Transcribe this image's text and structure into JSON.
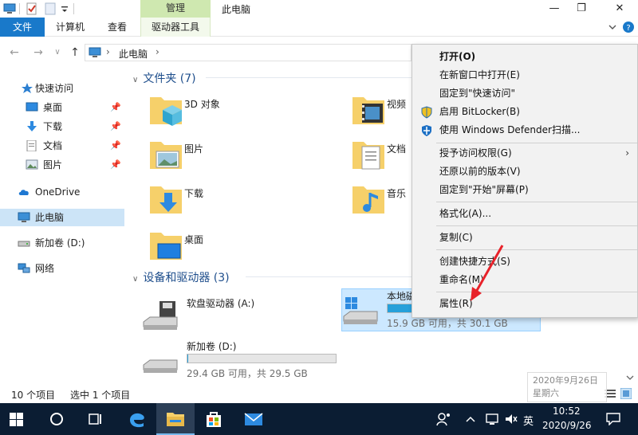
{
  "titlebar": {
    "manage_tab": "管理",
    "window_title": "此电脑",
    "min": "—",
    "max": "❐",
    "close": "✕"
  },
  "ribbon": {
    "tabs": [
      "文件",
      "计算机",
      "查看",
      "驱动器工具"
    ]
  },
  "address": {
    "back": "←",
    "forward": "→",
    "recent": "∨",
    "up": "↑",
    "path": "此电脑",
    "sep": "›"
  },
  "nav": {
    "quick_access": "快速访问",
    "quick_items": [
      "桌面",
      "下载",
      "文档",
      "图片"
    ],
    "onedrive": "OneDrive",
    "this_pc": "此电脑",
    "new_volume": "新加卷 (D:)",
    "network": "网络"
  },
  "content": {
    "folders_header": "文件夹 (7)",
    "folders": [
      "3D 对象",
      "视频",
      "图片",
      "文档",
      "下载",
      "音乐",
      "桌面"
    ],
    "devices_header": "设备和驱动器 (3)",
    "drives": [
      {
        "name": "软盘驱动器 (A:)",
        "free_text": "",
        "used_fraction": 0
      },
      {
        "name": "本地磁",
        "free_text": "15.9 GB 可用，共 30.1 GB",
        "used_fraction": 0.47
      },
      {
        "name": "新加卷 (D:)",
        "free_text": "29.4 GB 可用，共 29.5 GB",
        "used_fraction": 0.004
      }
    ]
  },
  "status": {
    "count": "10 个项目",
    "selected": "选中 1 个项目"
  },
  "context_menu": {
    "items": [
      "打开(O)",
      "在新窗口中打开(E)",
      "固定到\"快速访问\"",
      "启用 BitLocker(B)",
      "使用 Windows Defender扫描...",
      "授予访问权限(G)",
      "还原以前的版本(V)",
      "固定到\"开始\"屏幕(P)",
      "格式化(A)...",
      "复制(C)",
      "创建快捷方式(S)",
      "重命名(M)",
      "属性(R)"
    ],
    "submenu_arrow": "›"
  },
  "watermark": {
    "date": "2020年9月26日",
    "weekday": "星期六"
  },
  "taskbar": {
    "time": "10:52",
    "date": "2020/9/26",
    "ime": "英"
  },
  "colors": {
    "accent": "#1979ca",
    "manage": "#cfe8b0",
    "taskbar": "#0b1d33",
    "selection": "#cce4f7",
    "folder": "#f6d06a",
    "arrow": "#e8222a"
  }
}
